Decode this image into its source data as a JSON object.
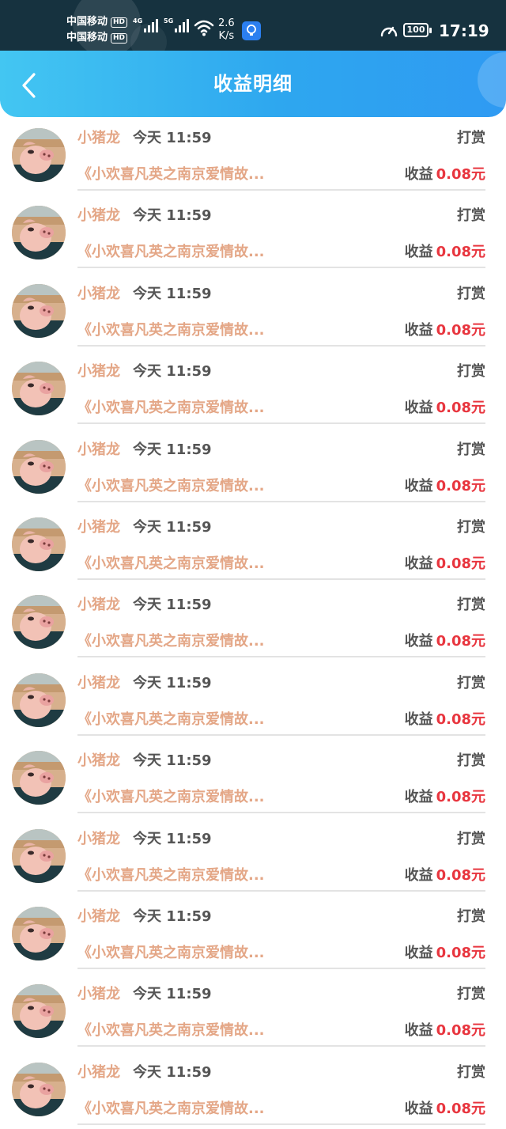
{
  "status_bar": {
    "carrier_1": "中国移动",
    "carrier_2": "中国移动",
    "hd_badge": "HD",
    "network_1": "4G",
    "network_2": "5G",
    "speed_value": "2.6",
    "speed_unit": "K/s",
    "battery": "100",
    "time": "17:19"
  },
  "header": {
    "title": "收益明细",
    "back_icon": "chevron-left-icon"
  },
  "list": {
    "items": [
      {
        "user": "小猪龙",
        "time": "今天 11:59",
        "type": "打赏",
        "work": "《小欢喜凡英之南京爱情故...",
        "earn_label": "收益",
        "amount": "0.08元"
      },
      {
        "user": "小猪龙",
        "time": "今天 11:59",
        "type": "打赏",
        "work": "《小欢喜凡英之南京爱情故...",
        "earn_label": "收益",
        "amount": "0.08元"
      },
      {
        "user": "小猪龙",
        "time": "今天 11:59",
        "type": "打赏",
        "work": "《小欢喜凡英之南京爱情故...",
        "earn_label": "收益",
        "amount": "0.08元"
      },
      {
        "user": "小猪龙",
        "time": "今天 11:59",
        "type": "打赏",
        "work": "《小欢喜凡英之南京爱情故...",
        "earn_label": "收益",
        "amount": "0.08元"
      },
      {
        "user": "小猪龙",
        "time": "今天 11:59",
        "type": "打赏",
        "work": "《小欢喜凡英之南京爱情故...",
        "earn_label": "收益",
        "amount": "0.08元"
      },
      {
        "user": "小猪龙",
        "time": "今天 11:59",
        "type": "打赏",
        "work": "《小欢喜凡英之南京爱情故...",
        "earn_label": "收益",
        "amount": "0.08元"
      },
      {
        "user": "小猪龙",
        "time": "今天 11:59",
        "type": "打赏",
        "work": "《小欢喜凡英之南京爱情故...",
        "earn_label": "收益",
        "amount": "0.08元"
      },
      {
        "user": "小猪龙",
        "time": "今天 11:59",
        "type": "打赏",
        "work": "《小欢喜凡英之南京爱情故...",
        "earn_label": "收益",
        "amount": "0.08元"
      },
      {
        "user": "小猪龙",
        "time": "今天 11:59",
        "type": "打赏",
        "work": "《小欢喜凡英之南京爱情故...",
        "earn_label": "收益",
        "amount": "0.08元"
      },
      {
        "user": "小猪龙",
        "time": "今天 11:59",
        "type": "打赏",
        "work": "《小欢喜凡英之南京爱情故...",
        "earn_label": "收益",
        "amount": "0.08元"
      },
      {
        "user": "小猪龙",
        "time": "今天 11:59",
        "type": "打赏",
        "work": "《小欢喜凡英之南京爱情故...",
        "earn_label": "收益",
        "amount": "0.08元"
      },
      {
        "user": "小猪龙",
        "time": "今天 11:59",
        "type": "打赏",
        "work": "《小欢喜凡英之南京爱情故...",
        "earn_label": "收益",
        "amount": "0.08元"
      },
      {
        "user": "小猪龙",
        "time": "今天 11:59",
        "type": "打赏",
        "work": "《小欢喜凡英之南京爱情故...",
        "earn_label": "收益",
        "amount": "0.08元"
      }
    ]
  },
  "colors": {
    "header_start": "#43c6f2",
    "header_end": "#2f9af2",
    "username": "#e4a787",
    "amount": "#e8363f",
    "status_bar": "#16323f"
  }
}
